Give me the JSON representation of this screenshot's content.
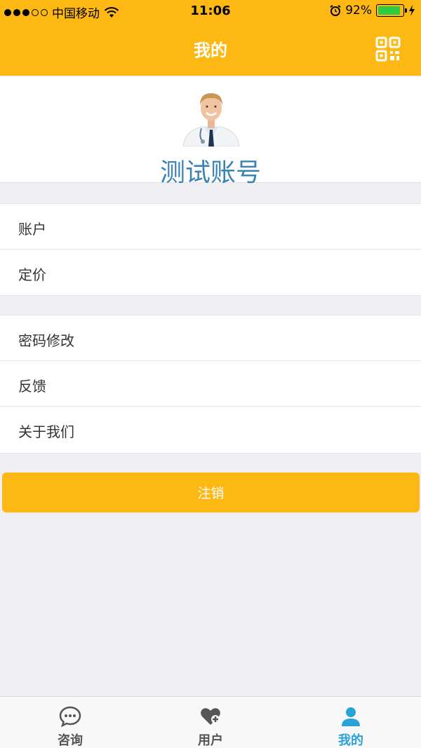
{
  "status_bar": {
    "carrier": "中国移动",
    "time": "11:06",
    "battery": "92%",
    "battery_level": 0.92,
    "icons": [
      "signal-dots-icon",
      "wifi-icon",
      "alarm-clock-icon",
      "battery-icon",
      "charging-bolt-icon"
    ]
  },
  "header": {
    "title": "我的",
    "right_icon": "qr-code-icon",
    "color": "#fdb813"
  },
  "profile": {
    "avatar_icon": "doctor-avatar",
    "name": "测试账号",
    "name_color": "#3a83b5"
  },
  "menu_groups": [
    {
      "items": [
        {
          "label": "账户"
        },
        {
          "label": "定价"
        }
      ]
    },
    {
      "items": [
        {
          "label": "密码修改"
        },
        {
          "label": "反馈"
        },
        {
          "label": "关于我们"
        }
      ]
    }
  ],
  "logout_button": {
    "label": "注销"
  },
  "tab_bar": {
    "tabs": [
      {
        "label": "咨询",
        "icon": "chat-bubble-icon",
        "active": false
      },
      {
        "label": "用户",
        "icon": "heart-plus-icon",
        "active": false
      },
      {
        "label": "我的",
        "icon": "person-icon",
        "active": true
      }
    ],
    "active_color": "#2aa3d6"
  }
}
